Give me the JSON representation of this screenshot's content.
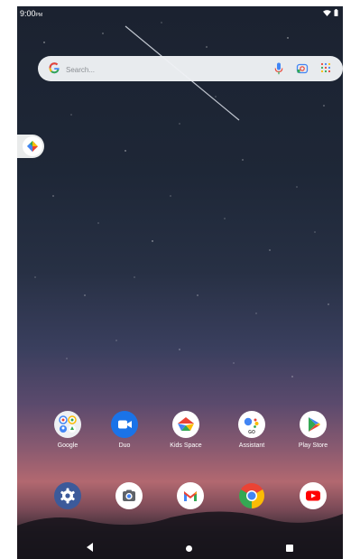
{
  "status_bar": {
    "time": "9:00",
    "ampm": "PM"
  },
  "search": {
    "placeholder": "Search..."
  },
  "home_apps": [
    {
      "label": "Google",
      "icon": "google-folder-icon"
    },
    {
      "label": "Duo",
      "icon": "duo-icon"
    },
    {
      "label": "Kids Space",
      "icon": "kids-space-icon"
    },
    {
      "label": "Assistant",
      "icon": "assistant-icon"
    },
    {
      "label": "Play Store",
      "icon": "play-store-icon"
    }
  ],
  "dock_apps": [
    {
      "icon": "settings-icon"
    },
    {
      "icon": "camera-icon"
    },
    {
      "icon": "gmail-icon"
    },
    {
      "icon": "chrome-icon"
    },
    {
      "icon": "youtube-icon"
    }
  ],
  "colors": {
    "google_blue": "#4285F4",
    "google_red": "#EA4335",
    "google_yellow": "#FBBC05",
    "google_green": "#34A853"
  }
}
